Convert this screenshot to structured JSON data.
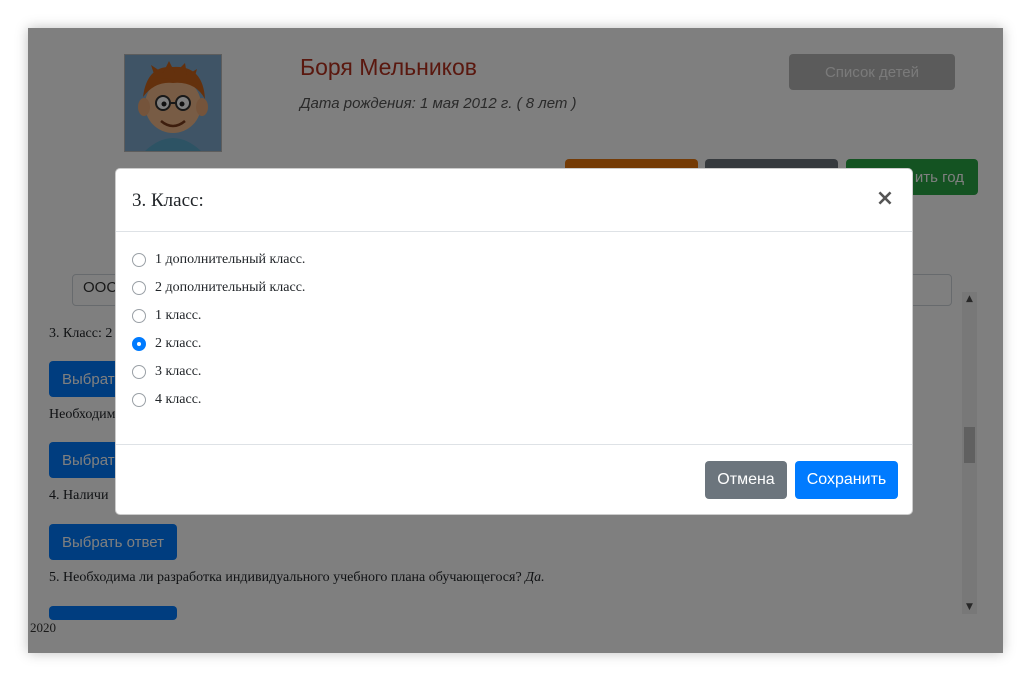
{
  "profile": {
    "name": "Боря Мельников",
    "birth_date": "Дата рождения: 1 мая 2012 г. ( 8 лет )"
  },
  "header_buttons": {
    "children_list": "Список детей",
    "green_partial": "ить год"
  },
  "form": {
    "select_partial": "ООС",
    "q3_partial": "3. Класс: 2",
    "q_need_partial": "Необходим",
    "q4_partial": "4. Наличи",
    "q5_text": "5. Необходима ли разработка индивидуального учебного плана обучающегося?",
    "q5_answer": "Да.",
    "choose_button_partial": "Выбрат",
    "choose_button": "Выбрать ответ"
  },
  "footer": {
    "year": "2020"
  },
  "modal": {
    "title": "3. Класс:",
    "close_glyph": "×",
    "options": [
      {
        "label": "1 дополнительный класс.",
        "checked": false
      },
      {
        "label": "2 дополнительный класс.",
        "checked": false
      },
      {
        "label": "1 класс.",
        "checked": false
      },
      {
        "label": "2 класс.",
        "checked": true
      },
      {
        "label": "3 класс.",
        "checked": false
      },
      {
        "label": "4 класс.",
        "checked": false
      }
    ],
    "cancel_label": "Отмена",
    "save_label": "Сохранить"
  },
  "colors": {
    "accent": "#007bff",
    "secondary": "#6c757d",
    "success": "#28a745",
    "warning": "#e8770d",
    "name": "#b5311f"
  },
  "icons": {
    "close": "close-icon",
    "scroll_up": "chevron-up-icon",
    "scroll_down": "chevron-down-icon"
  }
}
